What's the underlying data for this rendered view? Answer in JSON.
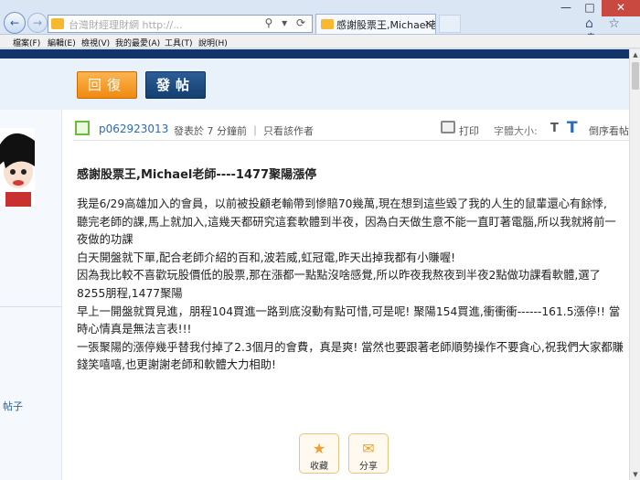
{
  "browser": {
    "address_text": "台灣財經理財網 http://...  ",
    "address_icons": "⚲ ▾ ⟳",
    "tab_title": "感謝股票王,Michael老師-...",
    "tab_close": "×",
    "window": {
      "min": "—",
      "max": "□",
      "close": "✕"
    },
    "tool_icons": "⌂ ☆ ⚙",
    "nav": {
      "back": "←",
      "forward": "→"
    }
  },
  "menubar": {
    "items": [
      "檔案(F)",
      "編輯(E)",
      "檢視(V)",
      "我的最愛(A)",
      "工具(T)",
      "說明(H)"
    ]
  },
  "toolbar": {
    "reply_label": "回復",
    "post_label": "發帖"
  },
  "sidebar": {
    "link_text": "帖子"
  },
  "post": {
    "username": "p062923013",
    "posted_text": "發表於 7 分鐘前 ｜ 只看該作者",
    "print_label": "打印",
    "fontsize_label": "字體大小:",
    "font_small": "T",
    "font_large": "T",
    "reverse_label": "倒序看帖",
    "title": "感謝股票王,Michael老師----1477聚陽漲停",
    "paragraphs": [
      "我是6/29高雄加入的會員，以前被投顧老輸帶到慘賠70幾萬,現在想到這些毀了我的人生的鼠輩還心有餘悸,",
      "聽完老師的課,馬上就加入,這幾天都研究這套軟體到半夜，因為白天做生意不能一直盯著電腦,所以我就將前一夜做的功課",
      "白天開盤就下單,配合老師介紹的百和,波若威,虹冠電,昨天出掉我都有小賺喔!",
      "因為我比較不喜歡玩股價低的股票,那在漲都一點點沒啥感覺,所以昨夜我熬夜到半夜2點做功課看軟體,選了8255朋程,1477聚陽",
      "早上一開盤就買見進，朋程104買進一路到底沒動有點可惜,可是呢! 聚陽154買進,衝衝衝------161.5漲停!! 當時心情真是無法言表!!!",
      "一張聚陽的漲停幾乎替我付掉了2.3個月的會費，真是爽! 當然也要跟著老師順勢操作不要貪心,祝我們大家都賺錢笑嘻嘻,也更謝謝老師和軟體大力相助!"
    ]
  },
  "actions": {
    "collect_label": "收藏",
    "collect_icon": "★",
    "share_label": "分享",
    "share_icon": "✉"
  },
  "scrollbar": {
    "up": "▲",
    "down": "▼"
  },
  "colors": {
    "accent_orange": "#f08a10",
    "accent_navy": "#143f70",
    "link_blue": "#2a6ab8"
  }
}
